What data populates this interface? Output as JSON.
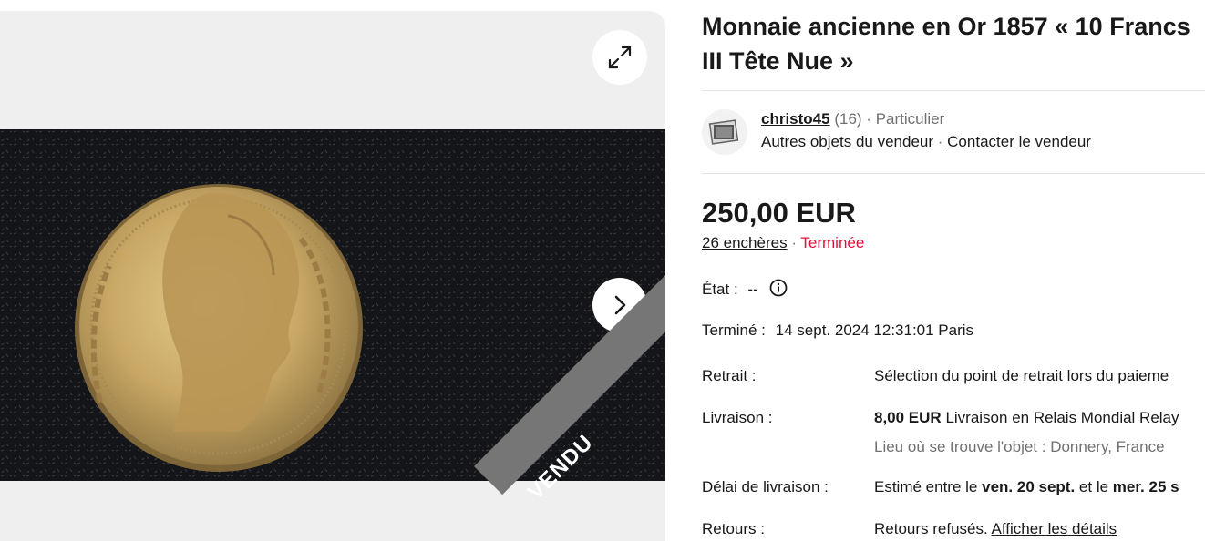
{
  "listing": {
    "title_line1": "Monnaie ancienne en Or 1857 « 10 Francs",
    "title_line2": "III Tête Nue »",
    "sold_banner": "VENDU"
  },
  "seller": {
    "name": "christo45",
    "feedback": "(16)",
    "separator": "·",
    "type": "Particulier",
    "other_items_link": "Autres objets du vendeur",
    "contact_link": "Contacter le vendeur"
  },
  "price": {
    "amount": "250,00 EUR",
    "bids_link": "26 enchères",
    "separator": "·",
    "status": "Terminée"
  },
  "details": {
    "etat_label": "État :",
    "etat_value": "--",
    "termine_label": "Terminé :",
    "termine_value": "14 sept. 2024 12:31:01 Paris",
    "retrait_label": "Retrait :",
    "retrait_value": "Sélection du point de retrait lors du paieme",
    "livraison_label": "Livraison :",
    "livraison_price": "8,00 EUR",
    "livraison_value": "Livraison en Relais Mondial Relay",
    "location_value": "Lieu où se trouve l'objet : Donnery, France",
    "delai_label": "Délai de livraison :",
    "delai_prefix": "Estimé entre le",
    "delai_date1": "ven. 20 sept.",
    "delai_mid": "et le",
    "delai_date2": "mer. 25 s",
    "retours_label": "Retours :",
    "retours_value": "Retours refusés.",
    "retours_link": "Afficher les détails"
  },
  "icons": {
    "expand": "expand-icon",
    "next": "chevron-right-icon",
    "info": "info-icon",
    "avatar": "seller-avatar-icon"
  },
  "colors": {
    "ended": "#e0103a",
    "sold_band": "#767676",
    "gallery_bg": "#efefef"
  }
}
